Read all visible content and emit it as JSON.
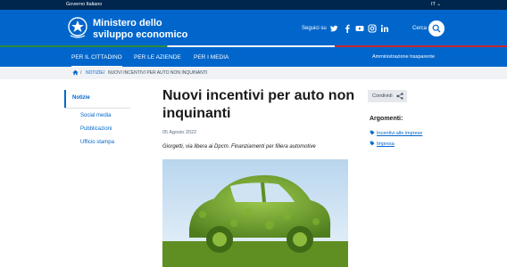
{
  "topbar": {
    "gov": "Governo Italiano",
    "lang": "IT ⌄"
  },
  "header": {
    "title_line1": "Ministero dello",
    "title_line2": "sviluppo economico",
    "follow": "Seguici su",
    "cerca": "Cerca"
  },
  "social": [
    "twitter-icon",
    "facebook-icon",
    "youtube-icon",
    "instagram-icon",
    "linkedin-icon"
  ],
  "nav": {
    "items": [
      "PER IL CITTADINO",
      "PER LE AZIENDE",
      "PER I MEDIA"
    ],
    "admin": "Amministrazione trasparente"
  },
  "breadcrumb": {
    "sep1": "/",
    "c1": "NOTIZIE",
    "sep2": "/",
    "c2": "NUOVI INCENTIVI PER AUTO NON INQUINANTI"
  },
  "sidebar": {
    "active": "Notizie",
    "items": [
      "Social media",
      "Pubblicazioni",
      "Ufficio stampa"
    ]
  },
  "article": {
    "title": "Nuovi incentivi per auto non inquinanti",
    "date": "05 Agosto 2022",
    "subtitle": "Giorgetti, via libera ai Dpcm. Finanziamenti per filiera automotive"
  },
  "aside": {
    "share": "Condividi",
    "arguments_label": "Argomenti:",
    "tags": [
      "Incentivi alle imprese",
      "Impresa"
    ]
  },
  "colors": {
    "primary": "#0066cc",
    "dark": "#00264d",
    "leaf": "#6a9c2f",
    "sky": "#cfe3f2"
  }
}
